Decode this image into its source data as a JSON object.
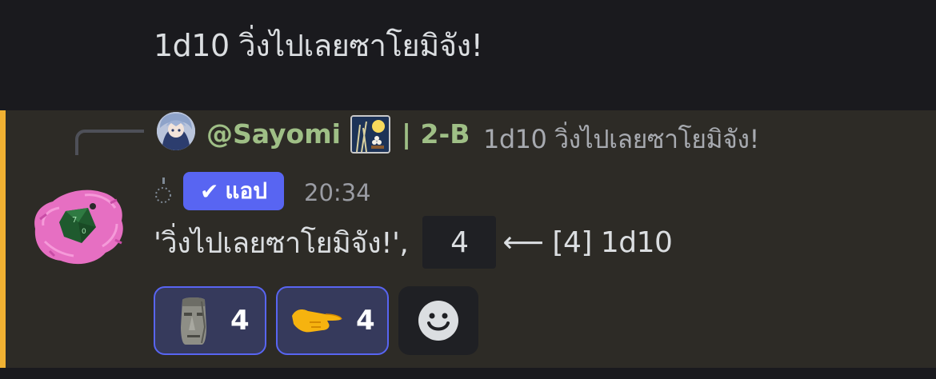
{
  "previous_message": {
    "text": "1d10 วิ่งไปเลยซาโยมิจัง!"
  },
  "reply": {
    "username": "@Sayomi",
    "role_icon": "moon-viewing-icon",
    "role": "| 2-B",
    "text": "1d10 วิ่งไปเลยซาโยมิจัง!"
  },
  "message": {
    "author_avatar": "pink-dice-bag-avatar",
    "badge": {
      "check": "✔",
      "label": "แอป"
    },
    "timestamp": "20:34",
    "content_prefix": "'วิ่งไปเลยซาโยมิจัง!',",
    "roll_value": "4",
    "content_suffix": "⟵ [4] 1d10"
  },
  "reactions": [
    {
      "emoji": "moai-icon",
      "count": "4"
    },
    {
      "emoji": "pointing-hand-icon",
      "count": "4"
    }
  ],
  "add_reaction": {
    "icon": "smiley-icon"
  },
  "colors": {
    "background": "#1a1a1e",
    "mention_background": "#2d2b26",
    "mention_bar": "#f0b132",
    "app_badge": "#5865f2",
    "role_color": "#9fbf86"
  }
}
